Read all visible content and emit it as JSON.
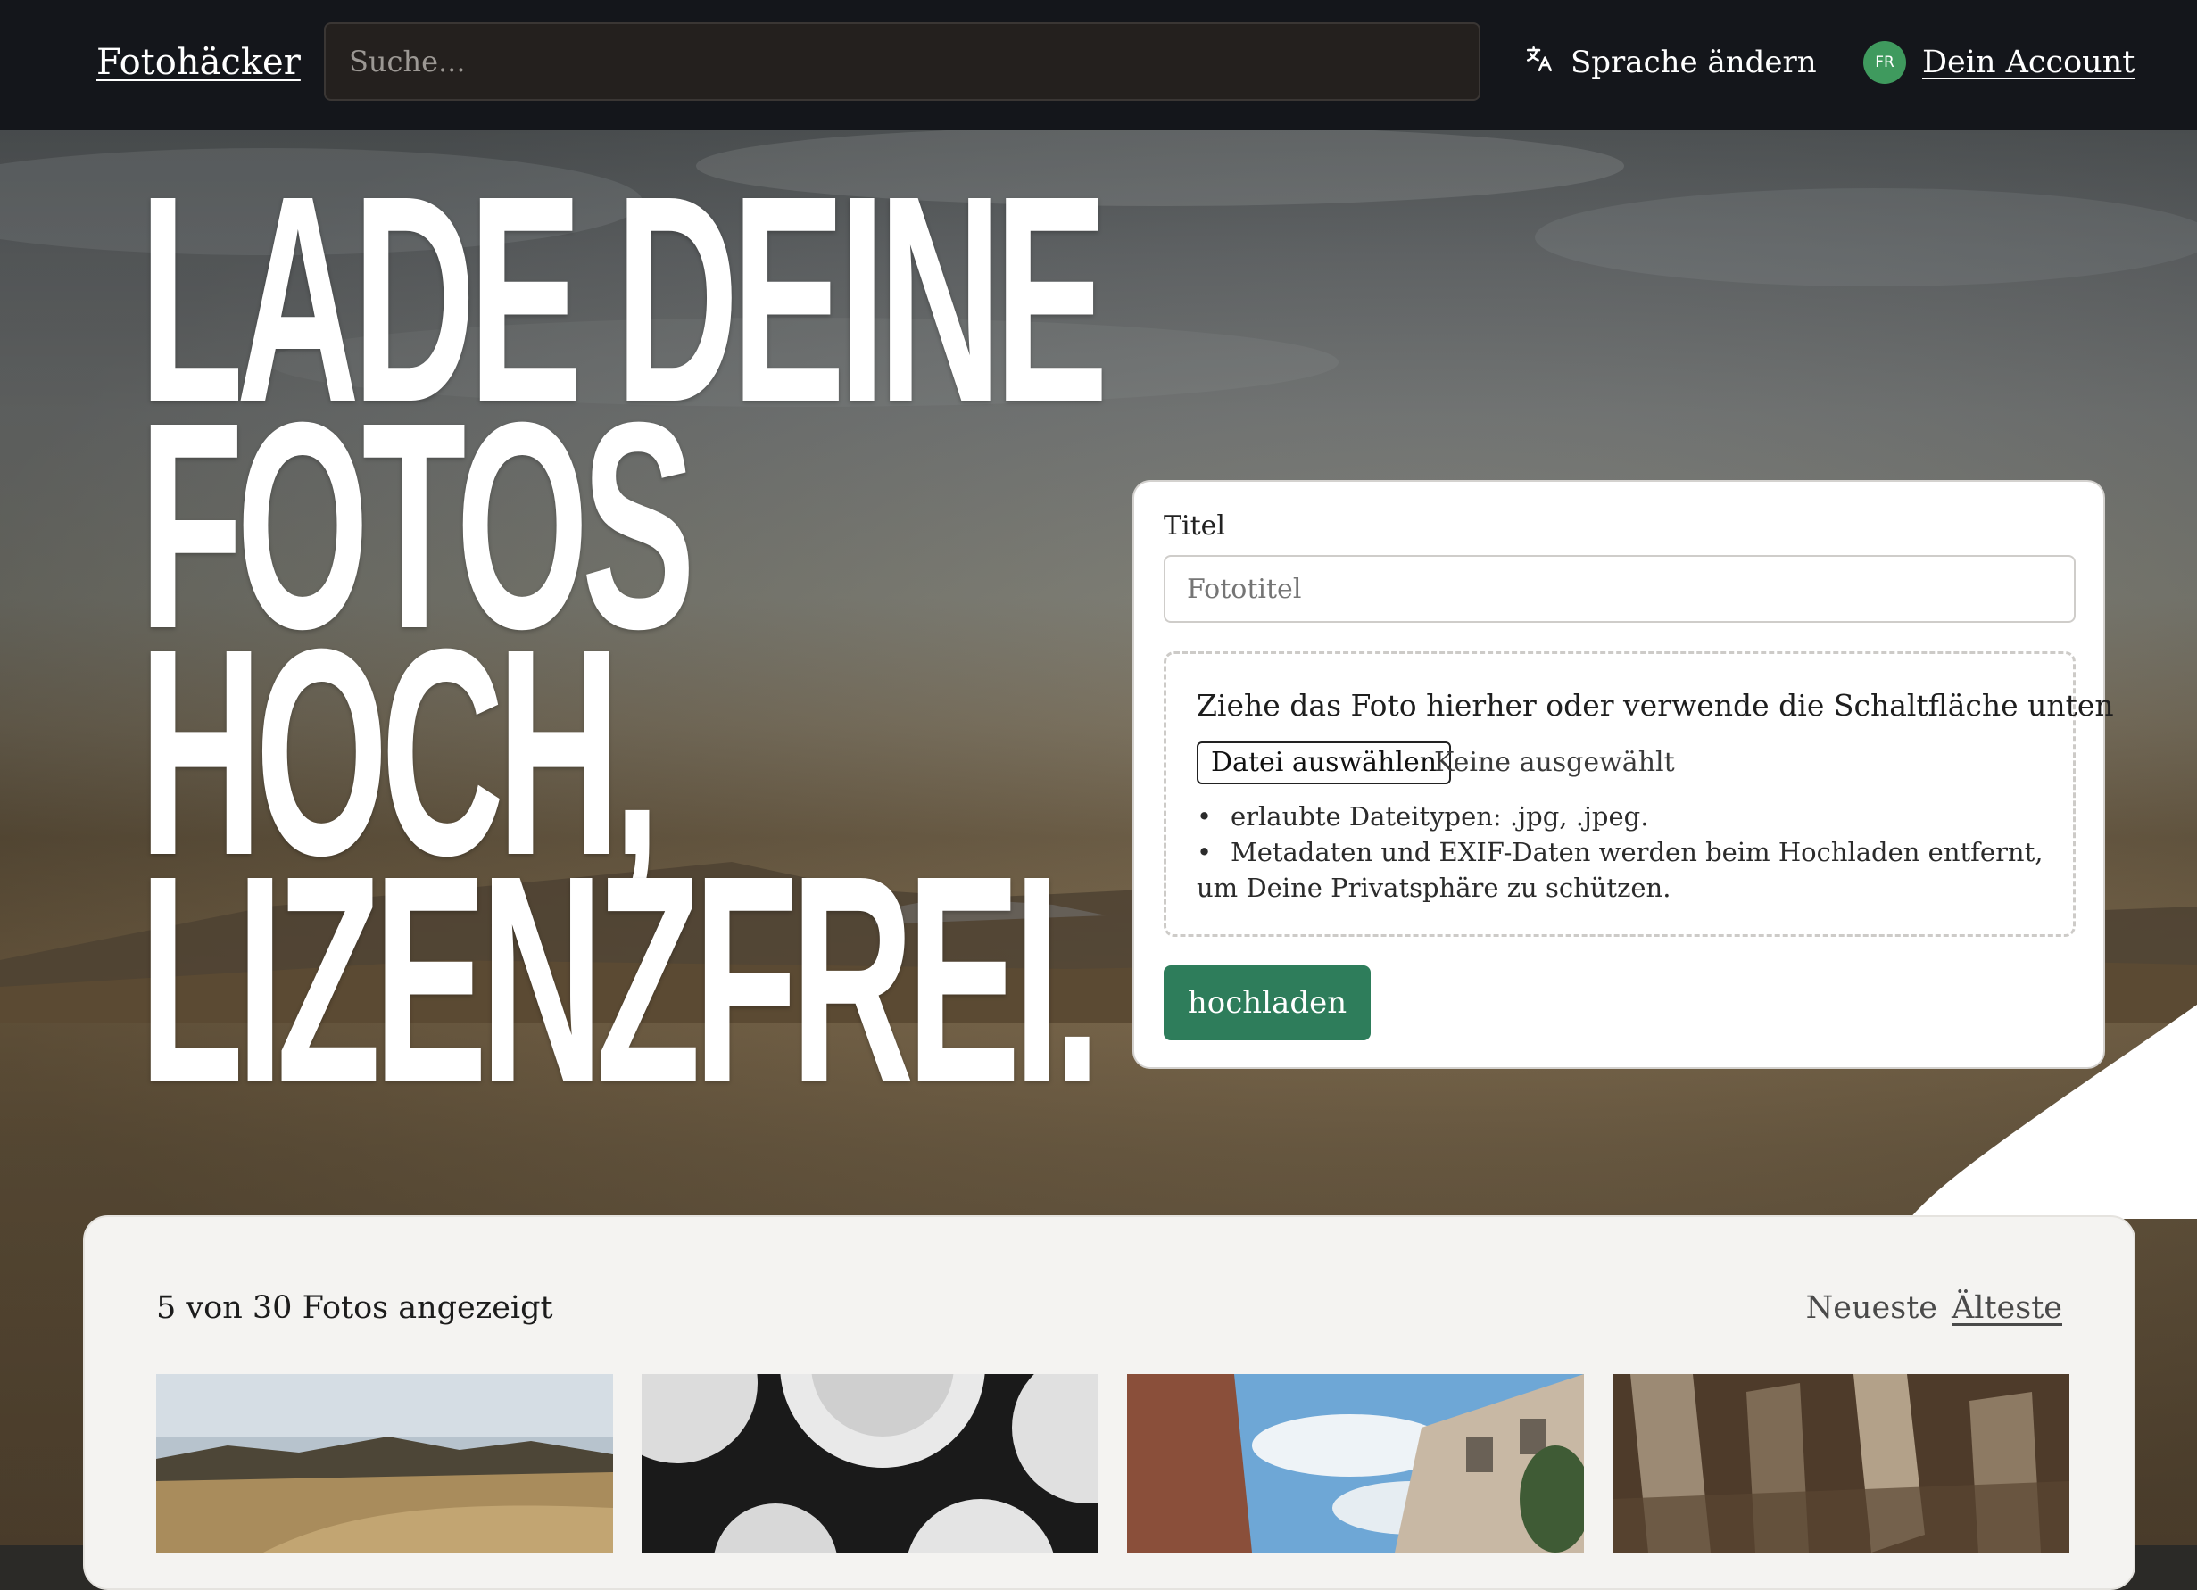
{
  "header": {
    "brand": "Fotohäcker",
    "search_placeholder": "Suche...",
    "language_label": "Sprache ändern",
    "avatar_initials": "FR",
    "account_label": "Dein Account"
  },
  "hero": {
    "headline_lines": [
      "LADE DEINE",
      "FOTOS",
      "HOCH,",
      "LIZENZFREI."
    ]
  },
  "upload_form": {
    "title_label": "Titel",
    "title_placeholder": "Fototitel",
    "dropzone_text": "Ziehe das Foto hierher oder verwende die Schaltfläche unten",
    "choose_file_label": "Datei auswählen",
    "file_status": "Keine ausgewählt",
    "hints": [
      "erlaubte Dateitypen: .jpg, .jpeg.",
      "Metadaten und EXIF-Daten werden beim Hochladen entfernt, um Deine Privatsphäre zu schützen."
    ],
    "submit_label": "hochladen"
  },
  "gallery": {
    "count_text": "5 von 30 Fotos angezeigt",
    "sort_options": [
      "Neueste",
      "Älteste"
    ],
    "active_sort": "Älteste"
  },
  "colors": {
    "navbar": "#14161b",
    "accent_green": "#2e7d5b",
    "avatar_green": "#3f9a5e",
    "panel": "#f4f3f1"
  },
  "icons": {
    "language": "translate-icon"
  }
}
